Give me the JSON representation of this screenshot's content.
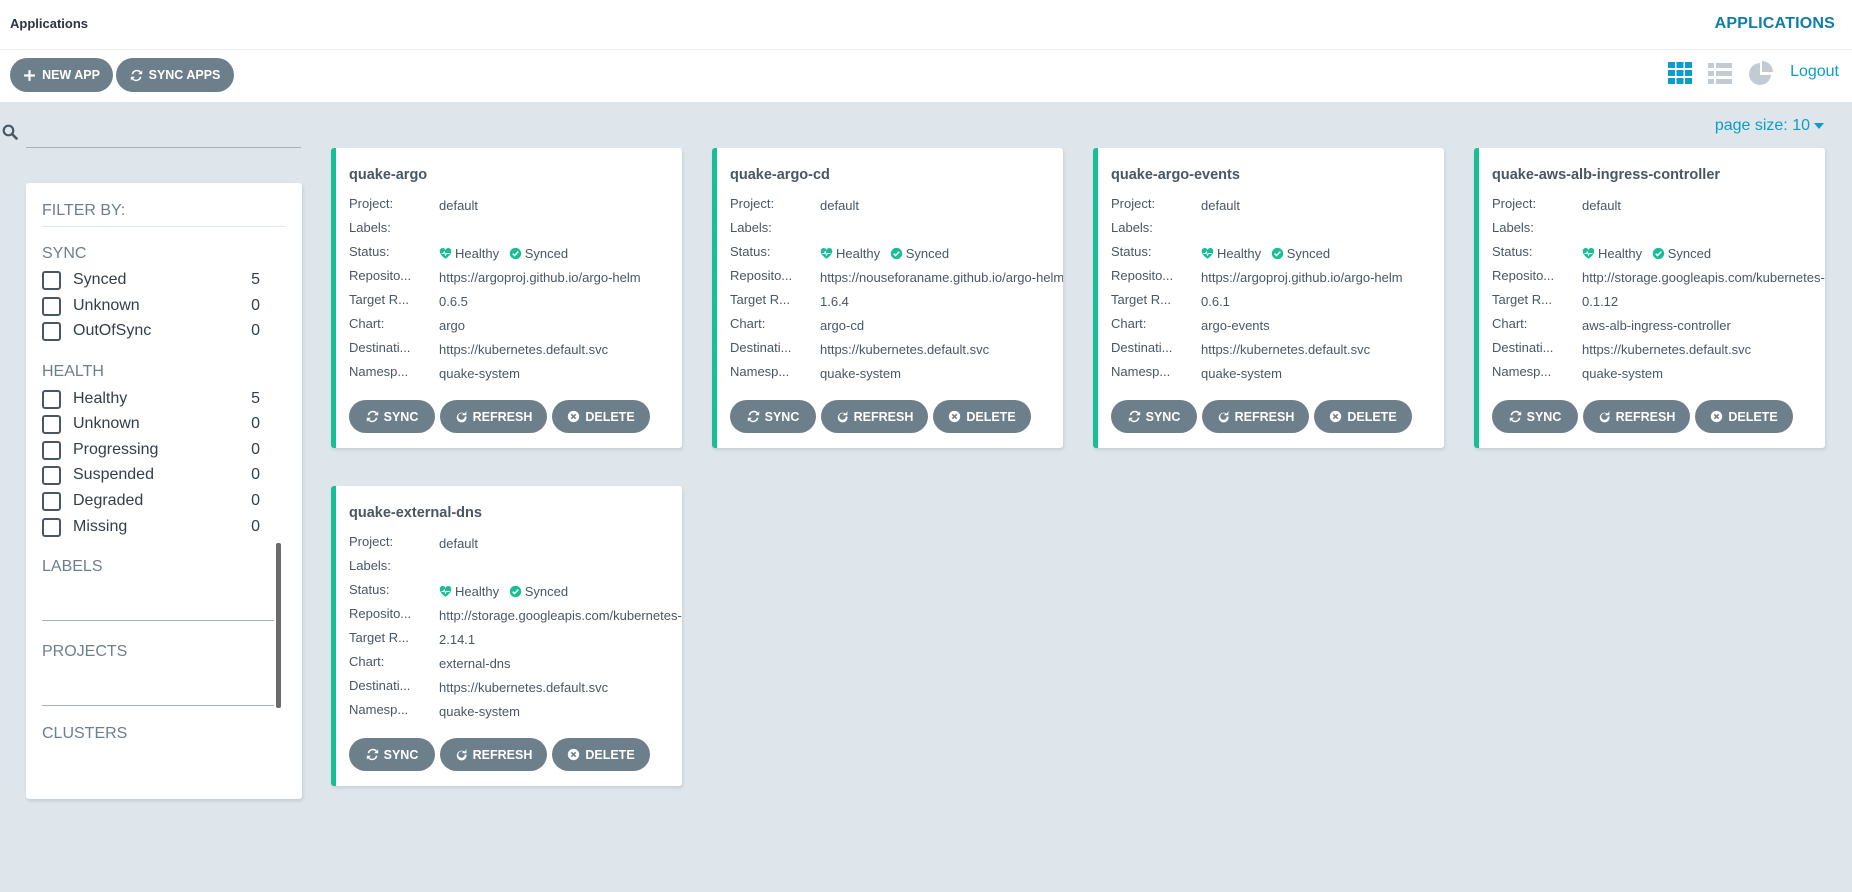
{
  "header": {
    "title": "Applications",
    "breadcrumb": "APPLICATIONS"
  },
  "toolbar": {
    "new_app": "NEW APP",
    "sync_apps": "SYNC APPS",
    "logout": "Logout",
    "views": [
      "tiles-view-icon",
      "list-view-icon",
      "summary-pie-icon"
    ]
  },
  "search": {
    "value": "",
    "placeholder": ""
  },
  "page_size": "page size: 10",
  "filter": {
    "title": "FILTER BY:",
    "sync": {
      "label": "SYNC",
      "items": [
        {
          "label": "Synced",
          "count": "5"
        },
        {
          "label": "Unknown",
          "count": "0"
        },
        {
          "label": "OutOfSync",
          "count": "0"
        }
      ]
    },
    "health": {
      "label": "HEALTH",
      "items": [
        {
          "label": "Healthy",
          "count": "5"
        },
        {
          "label": "Unknown",
          "count": "0"
        },
        {
          "label": "Progressing",
          "count": "0"
        },
        {
          "label": "Suspended",
          "count": "0"
        },
        {
          "label": "Degraded",
          "count": "0"
        },
        {
          "label": "Missing",
          "count": "0"
        }
      ]
    },
    "labels": "LABELS",
    "projects": "PROJECTS",
    "clusters": "CLUSTERS"
  },
  "row_labels": {
    "project": "Project:",
    "labels": "Labels:",
    "status": "Status:",
    "repo": "Reposito...",
    "target": "Target R...",
    "chart": "Chart:",
    "dest": "Destinati...",
    "ns": "Namesp..."
  },
  "status_text": {
    "health": "Healthy",
    "sync": "Synced"
  },
  "buttons": {
    "sync": "SYNC",
    "refresh": "REFRESH",
    "delete": "DELETE"
  },
  "apps": [
    {
      "name": "quake-argo",
      "project": "default",
      "labels": "",
      "repo": "https://argoproj.github.io/argo-helm",
      "target": "0.6.5",
      "chart": "argo",
      "dest": "https://kubernetes.default.svc",
      "ns": "quake-system"
    },
    {
      "name": "quake-argo-cd",
      "project": "default",
      "labels": "",
      "repo": "https://nouseforaname.github.io/argo-helm",
      "target": "1.6.4",
      "chart": "argo-cd",
      "dest": "https://kubernetes.default.svc",
      "ns": "quake-system"
    },
    {
      "name": "quake-argo-events",
      "project": "default",
      "labels": "",
      "repo": "https://argoproj.github.io/argo-helm",
      "target": "0.6.1",
      "chart": "argo-events",
      "dest": "https://kubernetes.default.svc",
      "ns": "quake-system"
    },
    {
      "name": "quake-aws-alb-ingress-controller",
      "project": "default",
      "labels": "",
      "repo": "http://storage.googleapis.com/kubernetes-charts-incubator",
      "target": "0.1.12",
      "chart": "aws-alb-ingress-controller",
      "dest": "https://kubernetes.default.svc",
      "ns": "quake-system"
    },
    {
      "name": "quake-external-dns",
      "project": "default",
      "labels": "",
      "repo": "http://storage.googleapis.com/kubernetes-charts",
      "target": "2.14.1",
      "chart": "external-dns",
      "dest": "https://kubernetes.default.svc",
      "ns": "quake-system"
    }
  ],
  "colors": {
    "accent": "#0d9dc9",
    "healthy": "#18be94",
    "button": "#6d7f8b"
  }
}
